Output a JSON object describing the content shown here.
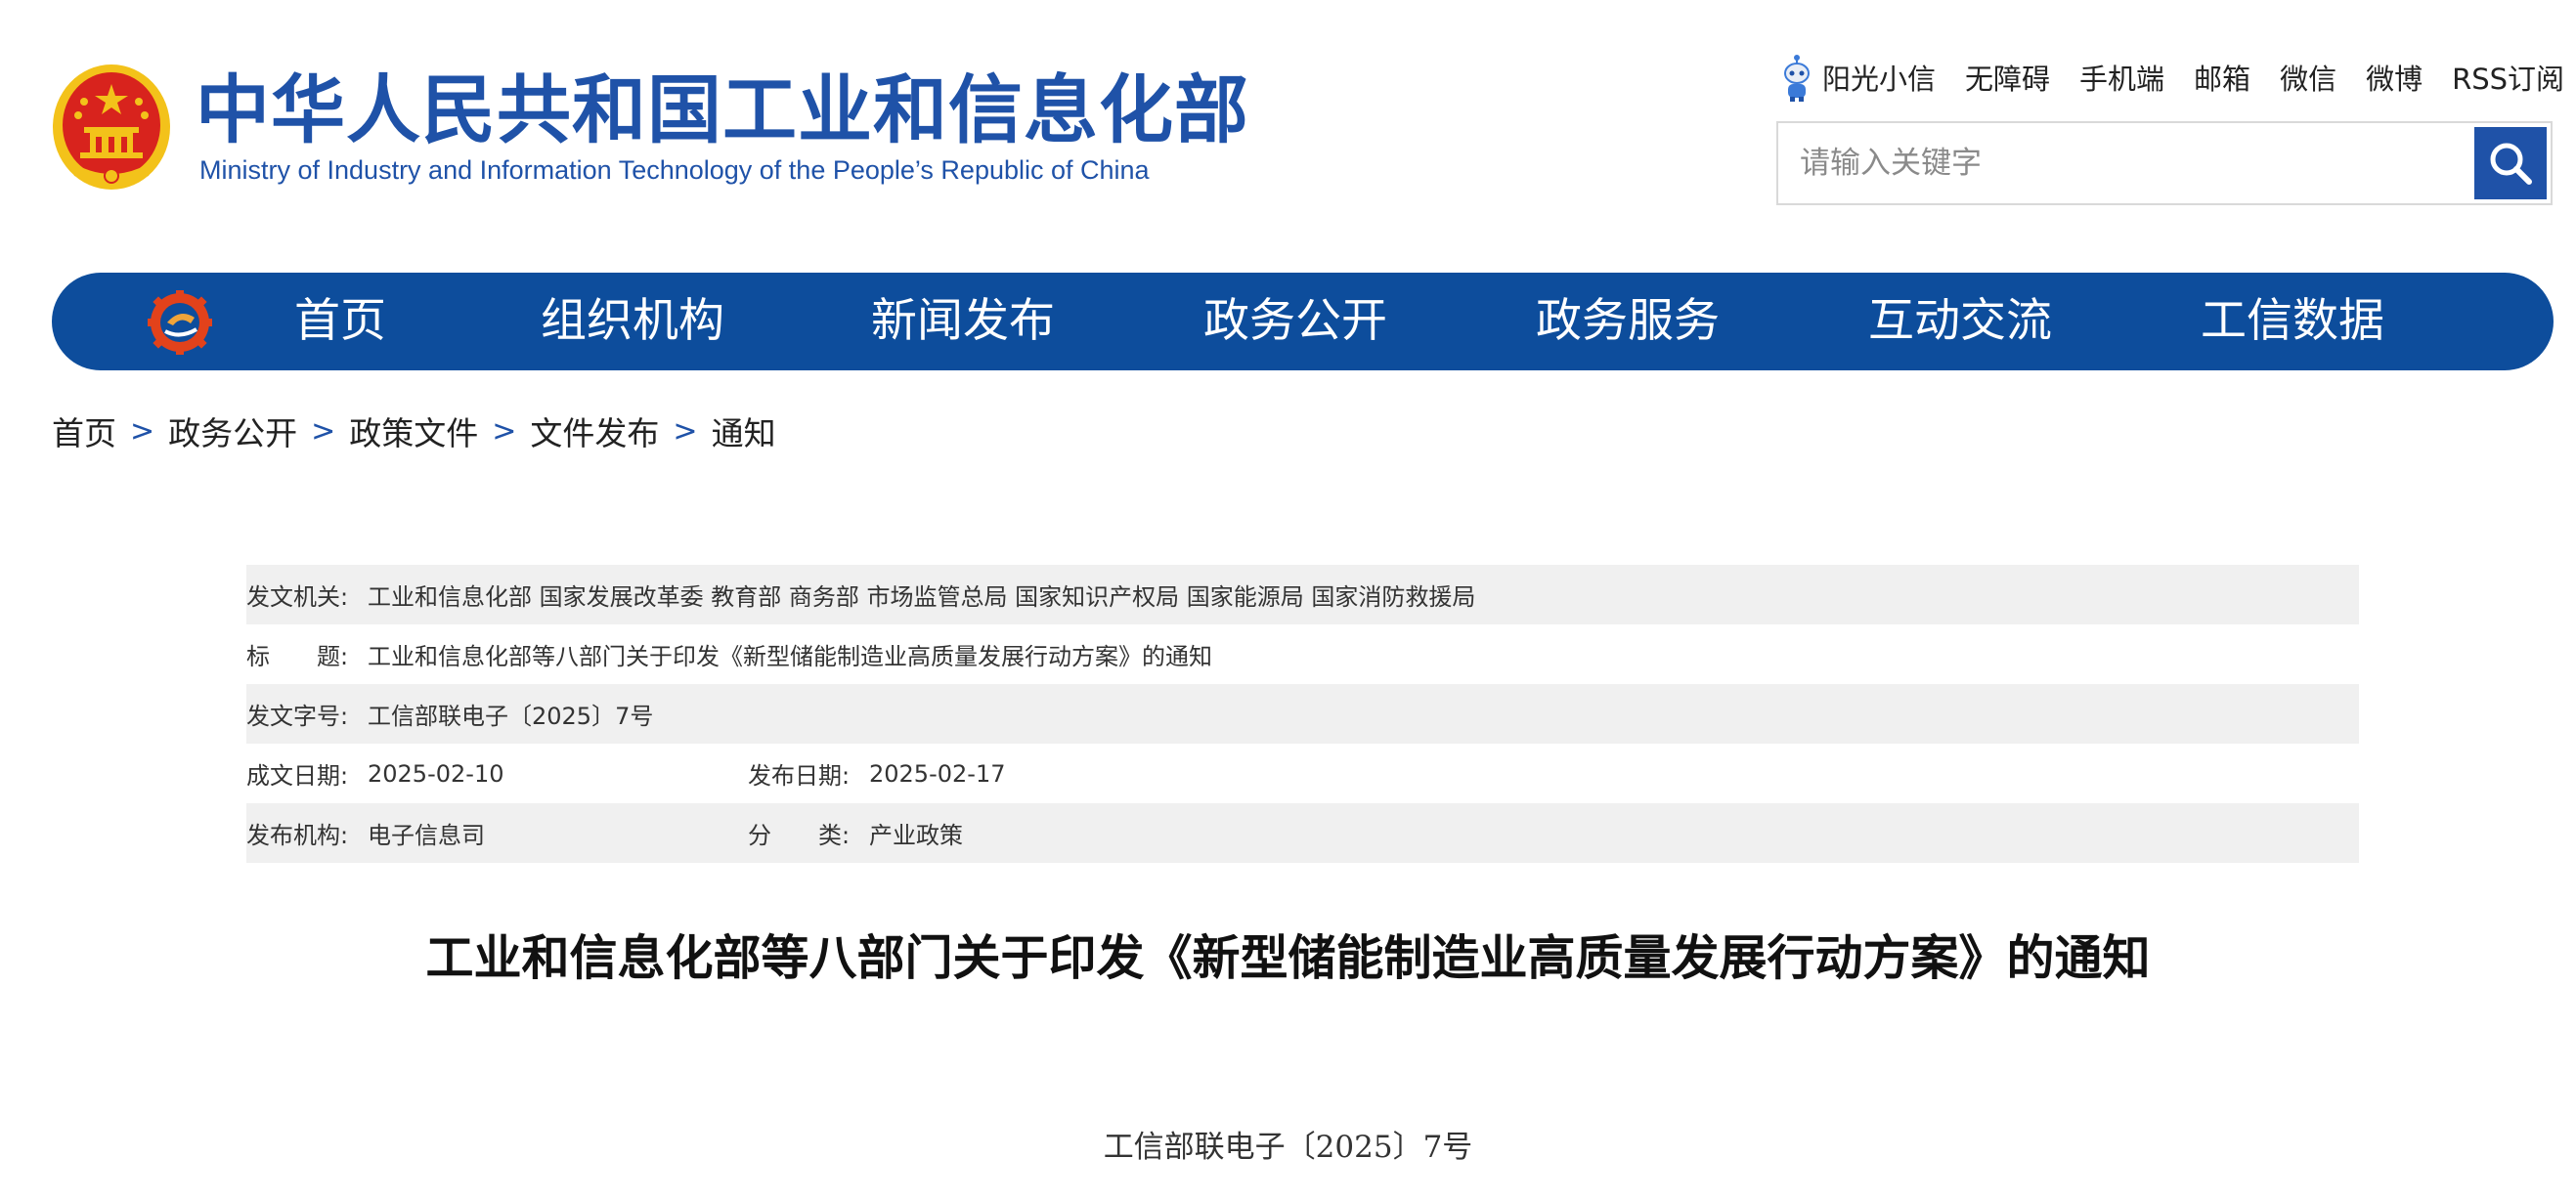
{
  "header": {
    "title_cn": "中华人民共和国工业和信息化部",
    "title_en": "Ministry of Industry and Information Technology of the People’s Republic of China",
    "top_links": [
      "阳光小信",
      "无障碍",
      "手机端",
      "邮箱",
      "微信",
      "微博",
      "RSS订阅"
    ],
    "search_placeholder": "请输入关键字"
  },
  "nav": {
    "items": [
      "首页",
      "组织机构",
      "新闻发布",
      "政务公开",
      "政务服务",
      "互动交流",
      "工信数据"
    ]
  },
  "breadcrumb": {
    "items": [
      "首页",
      "政务公开",
      "政策文件",
      "文件发布",
      "通知"
    ],
    "separator": ">"
  },
  "info": {
    "issuing_org_label": "发文机关:",
    "issuing_org_value": "工业和信息化部 国家发展改革委 教育部 商务部 市场监管总局 国家知识产权局 国家能源局 国家消防救援局",
    "title_label": "标　　题:",
    "title_value": "工业和信息化部等八部门关于印发《新型储能制造业高质量发展行动方案》的通知",
    "doc_no_label": "发文字号:",
    "doc_no_value": "工信部联电子〔2025〕7号",
    "written_date_label": "成文日期:",
    "written_date_value": "2025-02-10",
    "publish_date_label": "发布日期:",
    "publish_date_value": "2025-02-17",
    "publisher_label": "发布机构:",
    "publisher_value": "电子信息司",
    "category_label": "分　　类:",
    "category_value": "产业政策"
  },
  "article": {
    "title": "工业和信息化部等八部门关于印发《新型储能制造业高质量发展行动方案》的通知",
    "doc_number": "工信部联电子〔2025〕7号"
  },
  "colors": {
    "brand_blue": "#1f52a8",
    "nav_blue": "#0d4d9c",
    "row_shade": "#f0f0f0",
    "emblem_red": "#d8231d",
    "emblem_gold": "#f3c21a"
  }
}
